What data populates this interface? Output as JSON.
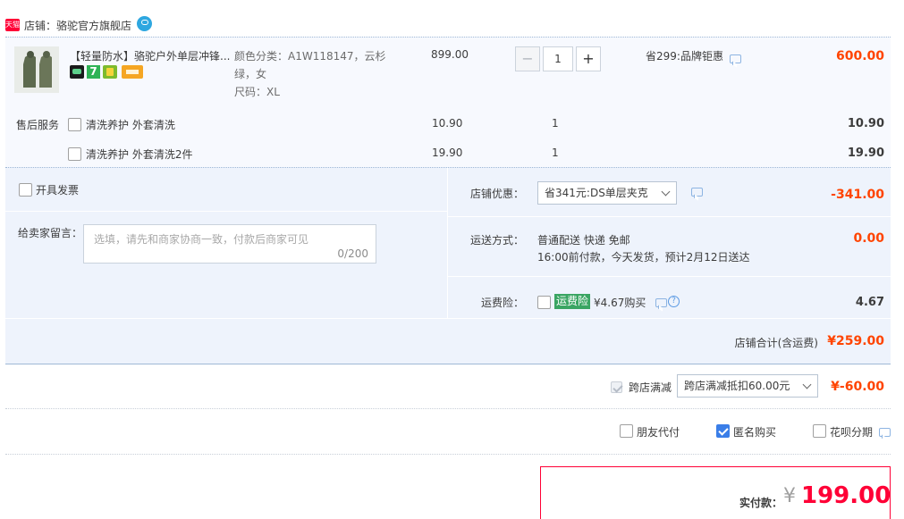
{
  "store": {
    "badge": "天猫",
    "label": "店铺：骆驼官方旗舰店"
  },
  "product": {
    "title": "【轻量防水】骆驼户外单层冲锋...",
    "sku_line1": "颜色分类：A1W118147，云杉",
    "sku_line2": "绿，女",
    "size": "尺码：XL",
    "price": "899.00",
    "quantity": "1",
    "minus": "−",
    "plus": "+",
    "promo": "省299:品牌钜惠",
    "subtotal": "600.00"
  },
  "service": {
    "label": "售后服务",
    "items": [
      {
        "name": "清洗养护 外套清洗",
        "price": "10.90",
        "qty": "1",
        "total": "10.90"
      },
      {
        "name": "清洗养护 外套清洗2件",
        "price": "19.90",
        "qty": "1",
        "total": "19.90"
      }
    ]
  },
  "invoice": {
    "label": "开具发票"
  },
  "message": {
    "label": "给卖家留言：",
    "placeholder": "选填，请先和商家协商一致，付款后商家可见",
    "counter": "0/200"
  },
  "shop_discount": {
    "label": "店铺优惠：",
    "selected": "省341元:DS单层夹克",
    "amount": "-341.00"
  },
  "shipping": {
    "label": "运送方式：",
    "method": "普通配送 快递 免邮",
    "eta": "16:00前付款，今天发货，预计2月12日送达",
    "amount": "0.00"
  },
  "insurance": {
    "label": "运费险：",
    "tag": "运费险",
    "price_text": "¥4.67购买",
    "help": "?",
    "amount": "4.67"
  },
  "shop_total": {
    "label": "店铺合计(含运费)",
    "amount": "¥259.00"
  },
  "cross_store": {
    "label": "跨店满减",
    "selected": "跨店满减抵扣60.00元",
    "amount": "¥-60.00"
  },
  "options": {
    "friend_pay": "朋友代付",
    "anonymous": "匿名购买",
    "huabei": "花呗分期"
  },
  "payment": {
    "label": "实付款：",
    "currency": "¥",
    "amount": "199.00"
  },
  "colors": {
    "accent_red": "#ff0036",
    "price_red": "#f40",
    "panel_bg": "#eef3fc",
    "row_bg": "#f7f9fe",
    "border_blue": "#9fb8d6",
    "check_blue": "#3a7ee8"
  }
}
